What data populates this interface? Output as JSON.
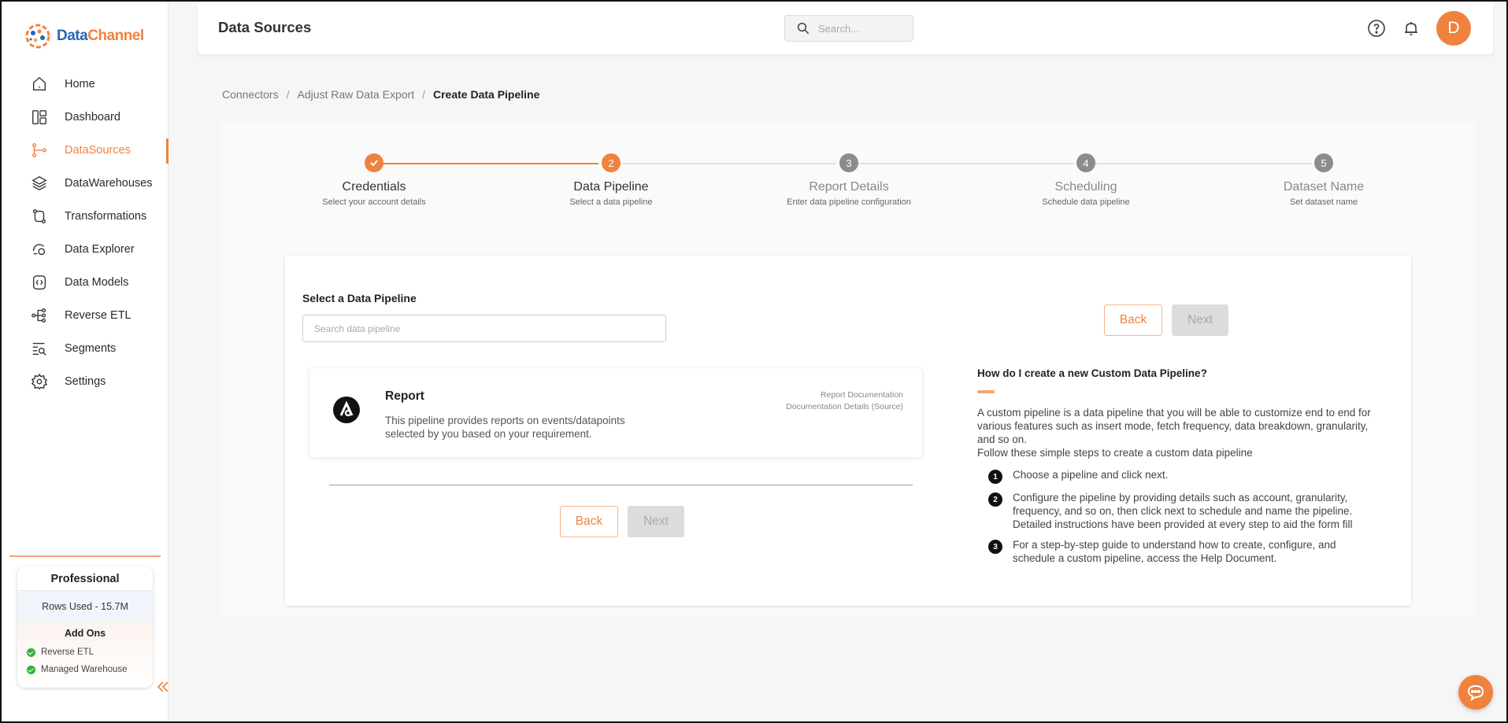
{
  "brand": {
    "part1": "Data",
    "part2": "Channel",
    "primary": "#2a63b8",
    "accent": "#f0823e"
  },
  "sidebar": {
    "items": [
      {
        "label": "Home",
        "icon": "home-icon"
      },
      {
        "label": "Dashboard",
        "icon": "dashboard-icon"
      },
      {
        "label": "DataSources",
        "icon": "datasources-icon",
        "active": true
      },
      {
        "label": "DataWarehouses",
        "icon": "database-stack-icon"
      },
      {
        "label": "Transformations",
        "icon": "transform-icon"
      },
      {
        "label": "Data Explorer",
        "icon": "explorer-icon"
      },
      {
        "label": "Data Models",
        "icon": "data-models-icon"
      },
      {
        "label": "Reverse ETL",
        "icon": "reverse-etl-icon"
      },
      {
        "label": "Segments",
        "icon": "segments-icon"
      },
      {
        "label": "Settings",
        "icon": "gear-icon"
      }
    ],
    "plan": {
      "name": "Professional",
      "rows_used": "Rows Used - 15.7M",
      "addons_title": "Add Ons",
      "addons": [
        "Reverse ETL",
        "Managed Warehouse"
      ]
    }
  },
  "header": {
    "title": "Data Sources",
    "search_placeholder": "Search...",
    "avatar_initial": "D"
  },
  "breadcrumb": [
    "Connectors",
    "Adjust Raw Data Export",
    "Create Data Pipeline"
  ],
  "stepper": {
    "steps": [
      {
        "number": "1",
        "title": "Credentials",
        "subtitle": "Select your account details",
        "status": "done"
      },
      {
        "number": "2",
        "title": "Data Pipeline",
        "subtitle": "Select a data pipeline",
        "status": "active"
      },
      {
        "number": "3",
        "title": "Report Details",
        "subtitle": "Enter data pipeline configuration",
        "status": "pending"
      },
      {
        "number": "4",
        "title": "Scheduling",
        "subtitle": "Schedule data pipeline",
        "status": "pending"
      },
      {
        "number": "5",
        "title": "Dataset Name",
        "subtitle": "Set dataset name",
        "status": "pending"
      }
    ]
  },
  "pipeline_select": {
    "label": "Select a Data Pipeline",
    "search_placeholder": "Search data pipeline",
    "pipelines": [
      {
        "name": "Report",
        "description": "This pipeline provides reports on events/datapoints selected by you based on your requirement.",
        "link1": "Report Documentation",
        "link2": "Documentation Details (Source)"
      }
    ]
  },
  "buttons": {
    "back": "Back",
    "next": "Next"
  },
  "help": {
    "title": "How do I create a new Custom Data Pipeline?",
    "intro": "A custom pipeline is a data pipeline that you will be able to customize end to end for various features such as insert mode, fetch frequency, data breakdown, granularity, and so on.",
    "intro2": "Follow these simple steps to create a custom data pipeline",
    "steps": [
      {
        "num": "1",
        "text": "Choose a pipeline and click next."
      },
      {
        "num": "2",
        "text": "Configure the pipeline by providing details such as account, granularity, frequency, and so on, then click next to schedule and name the pipeline. Detailed instructions have been provided at every step to aid the form fill"
      },
      {
        "num": "3",
        "text": "For a step-by-step guide to understand how to create, configure, and schedule a custom pipeline, access the Help Document."
      }
    ]
  }
}
